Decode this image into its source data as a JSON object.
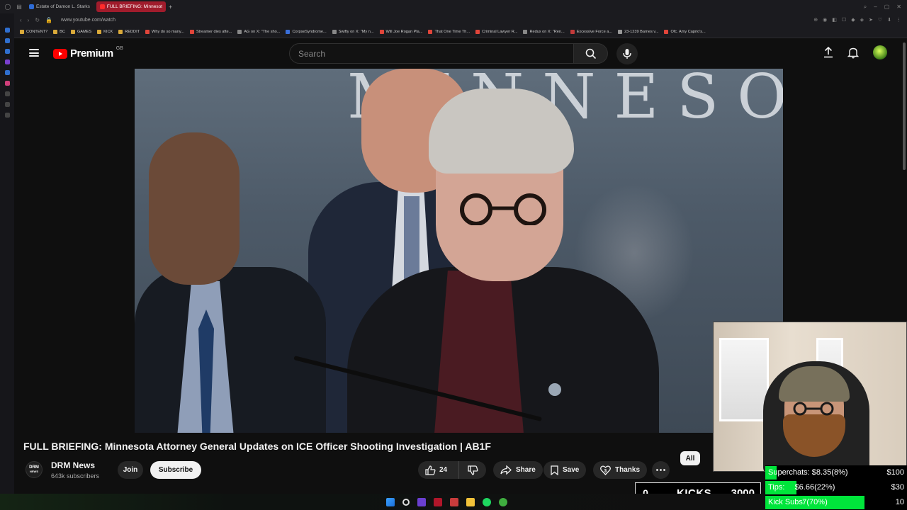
{
  "browser": {
    "tabs": [
      {
        "label": "Estate of Damon L. Starks",
        "active": false
      },
      {
        "label": "FULL BRIEFING: Minnesot",
        "active": true
      }
    ],
    "url": "www.youtube.com/watch",
    "bookmarks": [
      "CONTENT?",
      "BC",
      "GAMES",
      "KICK",
      "REDDIT",
      "Why do so many...",
      "Streamer dies afte...",
      "AG on X: \"The sho...",
      "CorpseSyndrome...",
      "Swifty on X: \"My n...",
      "Will Joe Rogan Pla...",
      "That One Time Th...",
      "Criminal Lawyer R...",
      "Redux on X: \"Ren...",
      "Excessive Force a...",
      "23-1239 Barnes v...",
      "Ofc. Amy Caprio's..."
    ]
  },
  "header": {
    "logo_text": "Premium",
    "country_code": "GB",
    "search_placeholder": "Search"
  },
  "video": {
    "sign_text": "MINNESO",
    "title": "FULL BRIEFING: Minnesota Attorney General Updates on ICE Officer Shooting Investigation | AB1F"
  },
  "channel": {
    "avatar_line1": "DRM",
    "avatar_line2": "NEWS",
    "name": "DRM News",
    "subscribers": "643k subscribers",
    "join_label": "Join",
    "subscribe_label": "Subscribe"
  },
  "actions": {
    "like_count": "24",
    "share_label": "Share",
    "save_label": "Save",
    "thanks_label": "Thanks"
  },
  "chips": {
    "all_label": "All"
  },
  "overlay": {
    "superchats": {
      "label": "Superchats: $8.35(8%)",
      "goal": "$100",
      "percent": 8
    },
    "tips": {
      "label": "Tips:",
      "value": "$6.66(22%)",
      "goal": "$30",
      "percent": 22
    },
    "kick_subs": {
      "label": "Kick Subs:",
      "value": "7(70%)",
      "goal": "10",
      "percent": 70
    },
    "kicks": {
      "count": "0",
      "label": "KICKS",
      "goal": "3000"
    }
  },
  "colors": {
    "youtube_red": "#ff0000",
    "background": "#0f0f0f",
    "progress_green": "#00e53b",
    "active_tab": "#a01c2c"
  }
}
